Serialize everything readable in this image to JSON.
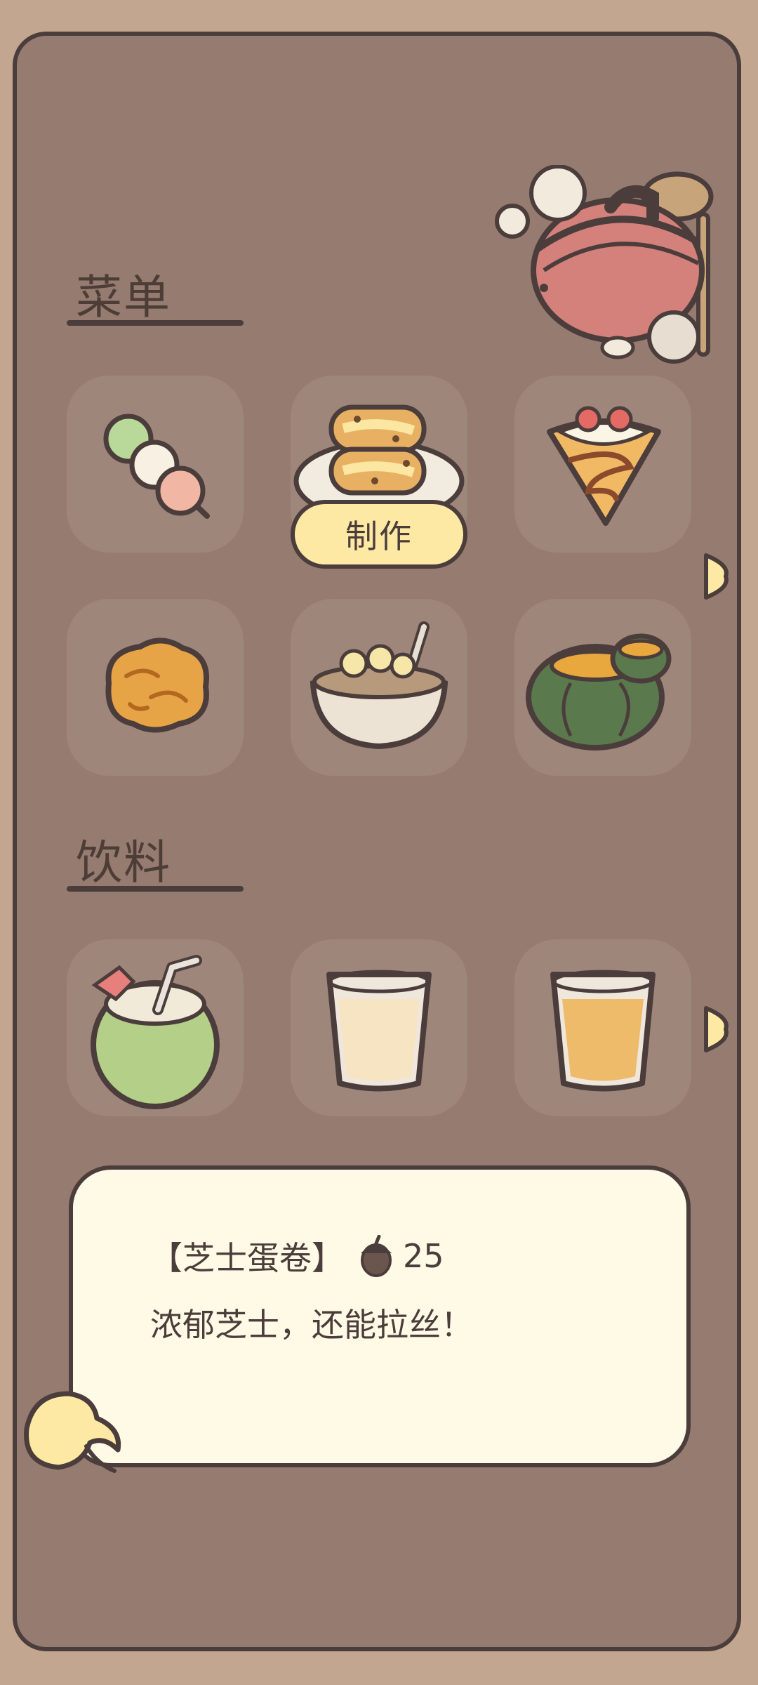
{
  "menu": {
    "title": "菜单",
    "items": [
      {
        "name": "dango"
      },
      {
        "name": "cheese-egg-roll",
        "selected": true
      },
      {
        "name": "crepe"
      },
      {
        "name": "fried-cake"
      },
      {
        "name": "banana-oatmeal"
      },
      {
        "name": "pumpkin-soup"
      }
    ],
    "make_label": "制作"
  },
  "drinks": {
    "title": "饮料",
    "items": [
      {
        "name": "coconut-drink"
      },
      {
        "name": "milk"
      },
      {
        "name": "juice"
      }
    ]
  },
  "detail": {
    "name": "【芝士蛋卷】",
    "price": "25",
    "description": "浓郁芝士，还能拉丝！"
  },
  "colors": {
    "background": "#c3a68f",
    "panel": "#957b70",
    "slot": "#9f867b",
    "button": "#fde9a3",
    "dialog": "#fefae6",
    "outline": "#4b3d3b"
  }
}
